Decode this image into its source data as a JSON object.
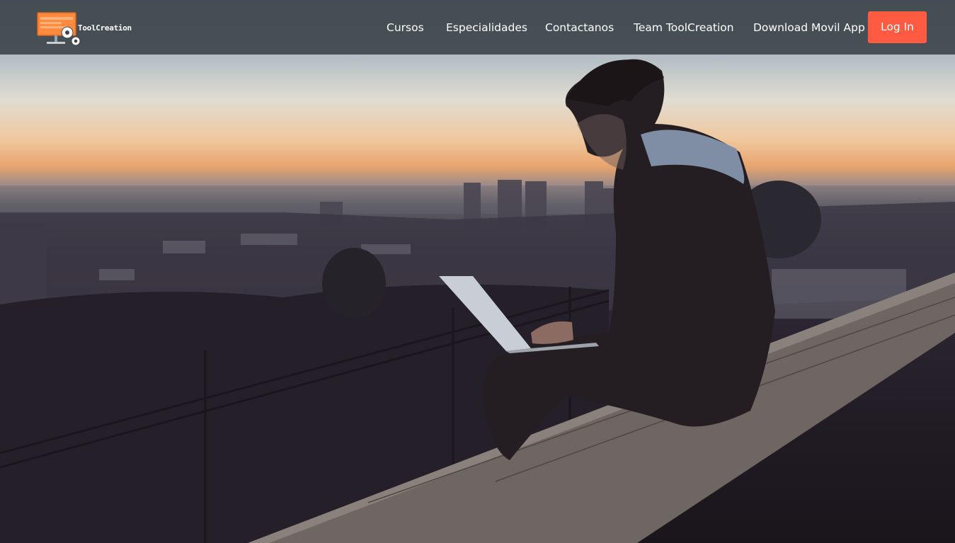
{
  "brand": {
    "logo_text": "ToolCreation",
    "logo_icon": "monitor-gears-icon",
    "accent": "#ff5a42"
  },
  "nav": {
    "items": [
      {
        "label": "Cursos"
      },
      {
        "label": "Especialidades"
      },
      {
        "label": "Contactanos"
      },
      {
        "label": "Team ToolCreation"
      },
      {
        "label": "Download Movil App"
      }
    ],
    "login_label": "Log In"
  },
  "hero": {
    "image": "man-with-laptop-at-dusk-over-city-photo"
  }
}
